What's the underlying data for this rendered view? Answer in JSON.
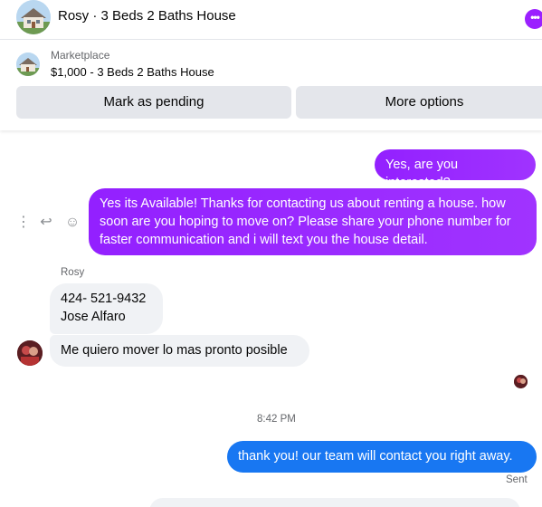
{
  "header": {
    "title": "Rosy · 3 Beds 2 Baths House",
    "avatar_icon": "house-photo-icon",
    "more_icon": "more-options-icon",
    "accent": "#9b20ff"
  },
  "listing": {
    "source": "Marketplace",
    "title": "$1,000 - 3 Beds 2 Baths House",
    "buttons": {
      "pending": "Mark as pending",
      "more": "More options"
    }
  },
  "conversation": {
    "messages": [
      {
        "direction": "outgoing",
        "text": "Yes, are you interested?"
      },
      {
        "direction": "outgoing",
        "text": "Yes its Available! Thanks for contacting us about renting a house. how soon are you hoping to move on? Please share your phone number for faster communication and i will text you the house detail."
      },
      {
        "direction": "incoming",
        "sender": "Rosy",
        "lines": [
          "424- 521-9432",
          "Jose Alfaro"
        ]
      },
      {
        "direction": "incoming",
        "text": "Me quiero mover lo mas pronto posible"
      },
      {
        "direction": "outgoing",
        "text": "thank you! our team will contact you right away.",
        "status": "Sent"
      }
    ],
    "time_separator": "8:42 PM",
    "message_actions": [
      "more-icon",
      "reply-icon",
      "react-icon"
    ]
  },
  "colors": {
    "outgoing_purple": "#9320ff",
    "outgoing_blue": "#1877f2",
    "incoming_gray": "#f0f2f5"
  }
}
